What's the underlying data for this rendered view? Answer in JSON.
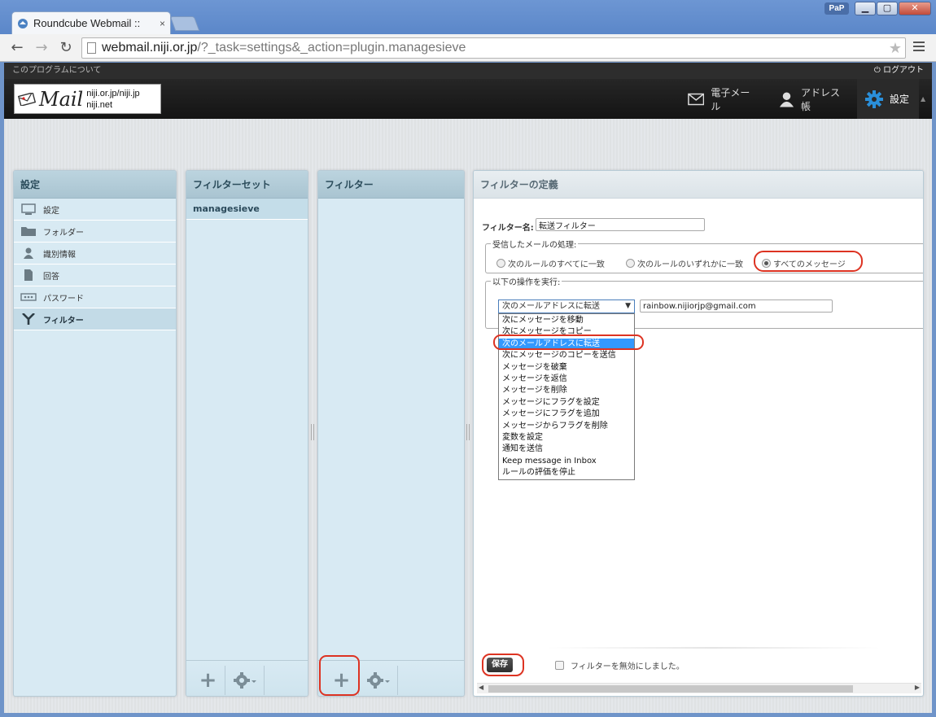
{
  "browser": {
    "tab_title": "Roundcube Webmail ::",
    "tab_close": "×",
    "pap": "PaP",
    "win_min": "▁",
    "win_max": "▢",
    "win_close": "✕",
    "url_host": "webmail.niji.or.jp",
    "url_path": "/?_task=settings&_action=plugin.managesieve"
  },
  "header": {
    "about": "このプログラムについて",
    "logout": "ログアウト",
    "logo_word": "Mail",
    "logo_domain_1": "niji.or.jp/niji.jp",
    "logo_domain_2": "niji.net",
    "nav": {
      "mail": "電子メール",
      "addressbook": "アドレス帳",
      "settings": "設定"
    }
  },
  "settings_panel": {
    "title": "設定",
    "items": [
      {
        "label": "設定",
        "icon": "computer-icon"
      },
      {
        "label": "フォルダー",
        "icon": "folder-icon"
      },
      {
        "label": "識別情報",
        "icon": "person-icon"
      },
      {
        "label": "回答",
        "icon": "document-icon"
      },
      {
        "label": "パスワード",
        "icon": "password-icon"
      },
      {
        "label": "フィルター",
        "icon": "filter-icon"
      }
    ],
    "selected": "フィルター"
  },
  "filter_sets_panel": {
    "title": "フィルターセット",
    "items": [
      "managesieve"
    ]
  },
  "filters_panel": {
    "title": "フィルター"
  },
  "definition": {
    "title": "フィルターの定義",
    "name_label": "フィルター名:",
    "name_value": "転送フィルター",
    "match_legend": "受信したメールの処理:",
    "match_options": [
      "次のルールのすべてに一致",
      "次のルールのいずれかに一致",
      "すべてのメッセージ"
    ],
    "match_selected": "すべてのメッセージ",
    "action_legend": "以下の操作を実行:",
    "action_selected": "次のメールアドレスに転送",
    "action_arrow": "▼",
    "forward_address": "rainbow.nijiorjp@gmail.com",
    "action_options": [
      "次にメッセージを移動",
      "次にメッセージをコピー",
      "次のメールアドレスに転送",
      "次にメッセージのコピーを送信",
      "メッセージを破棄",
      "メッセージを返信",
      "メッセージを削除",
      "メッセージにフラグを設定",
      "メッセージにフラグを追加",
      "メッセージからフラグを削除",
      "変数を設定",
      "通知を送信",
      "Keep message in Inbox",
      "ルールの評価を停止"
    ],
    "save": "保存",
    "disable_label": "フィルターを無効にしました。"
  },
  "colors": {
    "highlight": "#3399ff",
    "annotation_ring": "#dd3322"
  }
}
